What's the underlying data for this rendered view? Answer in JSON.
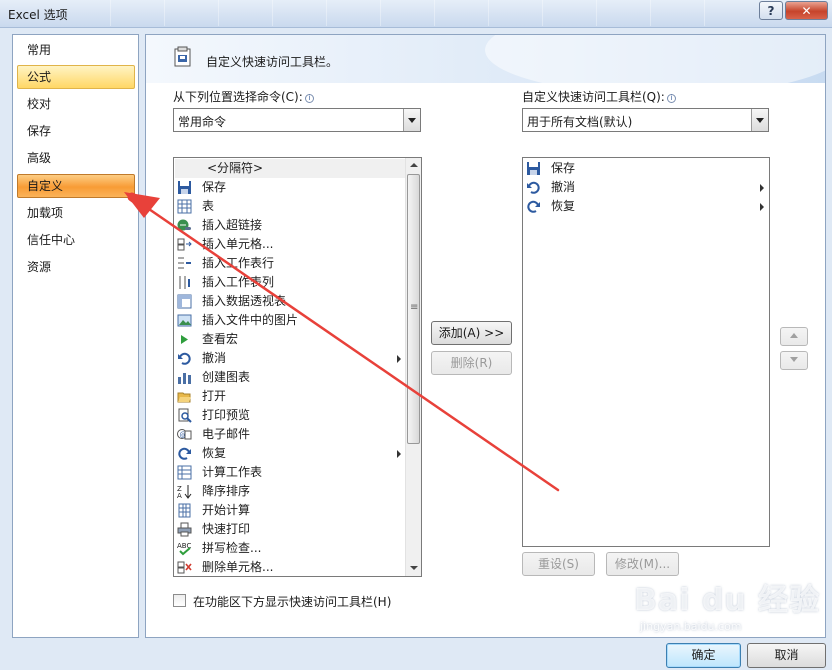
{
  "window": {
    "title": "Excel 选项",
    "help_label": "?",
    "close_label": "✕"
  },
  "nav": {
    "items": [
      {
        "label": "常用"
      },
      {
        "label": "公式"
      },
      {
        "label": "校对"
      },
      {
        "label": "保存"
      },
      {
        "label": "高级"
      },
      {
        "label": "自定义"
      },
      {
        "label": "加载项"
      },
      {
        "label": "信任中心"
      },
      {
        "label": "资源"
      }
    ],
    "hovered": "公式",
    "selected": "自定义"
  },
  "header": {
    "title": "自定义快速访问工具栏。"
  },
  "left_panel": {
    "label": "从下列位置选择命令(C):",
    "combo_value": "常用命令",
    "commands": [
      {
        "label": "<分隔符>",
        "icon": "separator"
      },
      {
        "label": "保存",
        "icon": "save-icon"
      },
      {
        "label": "表",
        "icon": "table-icon"
      },
      {
        "label": "插入超链接",
        "icon": "hyperlink-icon"
      },
      {
        "label": "插入单元格...",
        "icon": "insert-cells-icon"
      },
      {
        "label": "插入工作表行",
        "icon": "insert-row-icon"
      },
      {
        "label": "插入工作表列",
        "icon": "insert-column-icon"
      },
      {
        "label": "插入数据透视表",
        "icon": "pivot-table-icon"
      },
      {
        "label": "插入文件中的图片",
        "icon": "picture-icon"
      },
      {
        "label": "查看宏",
        "icon": "macro-icon"
      },
      {
        "label": "撤消",
        "icon": "undo-icon",
        "submenu": true
      },
      {
        "label": "创建图表",
        "icon": "chart-icon"
      },
      {
        "label": "打开",
        "icon": "open-folder-icon"
      },
      {
        "label": "打印预览",
        "icon": "print-preview-icon"
      },
      {
        "label": "电子邮件",
        "icon": "email-icon"
      },
      {
        "label": "恢复",
        "icon": "redo-icon",
        "submenu": true
      },
      {
        "label": "计算工作表",
        "icon": "calculate-sheet-icon"
      },
      {
        "label": "降序排序",
        "icon": "sort-descending-icon"
      },
      {
        "label": "开始计算",
        "icon": "calculate-icon"
      },
      {
        "label": "快速打印",
        "icon": "quick-print-icon"
      },
      {
        "label": "拼写检查...",
        "icon": "spelling-icon"
      },
      {
        "label": "删除单元格...",
        "icon": "delete-cells-icon"
      }
    ]
  },
  "right_panel": {
    "label": "自定义快速访问工具栏(Q):",
    "combo_value": "用于所有文档(默认)",
    "commands": [
      {
        "label": "保存",
        "icon": "save-icon"
      },
      {
        "label": "撤消",
        "icon": "undo-icon",
        "submenu": true
      },
      {
        "label": "恢复",
        "icon": "redo-icon",
        "submenu": true
      }
    ]
  },
  "buttons": {
    "add": "添加(A) >>",
    "remove": "删除(R)",
    "reset": "重设(S)",
    "modify": "修改(M)...",
    "ok": "确定",
    "cancel": "取消"
  },
  "checkbox": {
    "label": "在功能区下方显示快速访问工具栏(H)",
    "checked": false
  },
  "watermark": {
    "brand": "Bai du 经验",
    "url": "jingyan.baidu.com"
  },
  "colors": {
    "selected_nav": "#f89c35",
    "hover_nav": "#ffd766",
    "annotation_arrow": "#e8413a"
  }
}
